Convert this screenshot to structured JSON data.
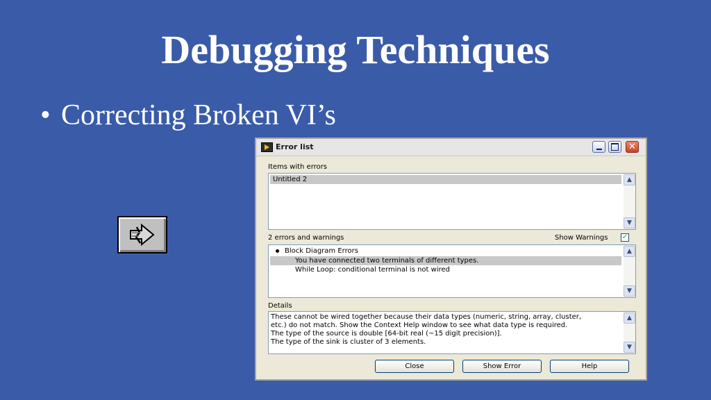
{
  "slide": {
    "title": "Debugging Techniques",
    "bullet_marker": "•",
    "bullet": "Correcting Broken VI’s",
    "run_button_icon": "broken-run-arrow-icon"
  },
  "window": {
    "title": "Error list",
    "controls": {
      "minimize": "minimize-icon",
      "maximize": "maximize-icon",
      "close": "✕"
    },
    "items_label": "Items with errors",
    "items": [
      {
        "label": "Untitled 2",
        "selected": true
      }
    ],
    "errors_count_label": "2 errors and warnings",
    "show_warnings_label": "Show Warnings",
    "show_warnings_checked": true,
    "errors": [
      {
        "label": "Block Diagram Errors",
        "bullet": true,
        "selected": false
      },
      {
        "label": "You have connected two terminals of different types.",
        "bullet": false,
        "selected": true
      },
      {
        "label": "While Loop: conditional terminal is not wired",
        "bullet": false,
        "selected": false
      }
    ],
    "details_label": "Details",
    "details_lines": [
      "These cannot be wired together because their data types (numeric, string, array, cluster,",
      "etc.) do not match. Show the Context Help window to see what data type is required.",
      "The type of the source is double [64-bit real (~15 digit precision)].",
      "The type of the sink is cluster of 3 elements."
    ],
    "buttons": {
      "close": "Close",
      "show_error": "Show Error",
      "help": "Help"
    }
  },
  "colors": {
    "slide_background": "#3a5ba8",
    "selection": "#c8c8c8",
    "dialog_background": "#ece9d8"
  }
}
